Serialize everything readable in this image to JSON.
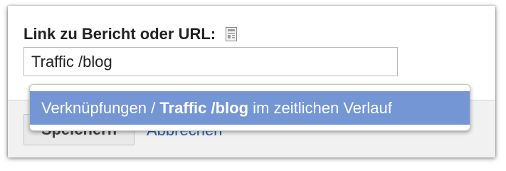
{
  "form": {
    "label": "Link zu Bericht oder URL:",
    "input_value": "Traffic /blog",
    "report_icon": "report-page-icon"
  },
  "buttons": {
    "save_label": "Speichern",
    "cancel_label": "Abbrechen"
  },
  "autocomplete": {
    "suggestion_prefix": "Verknüpfungen / ",
    "suggestion_bold": "Traffic /blog",
    "suggestion_suffix": " im zeitlichen Verlauf"
  },
  "colors": {
    "suggestion_highlight": "#7496d4",
    "link": "#2a5db0"
  }
}
